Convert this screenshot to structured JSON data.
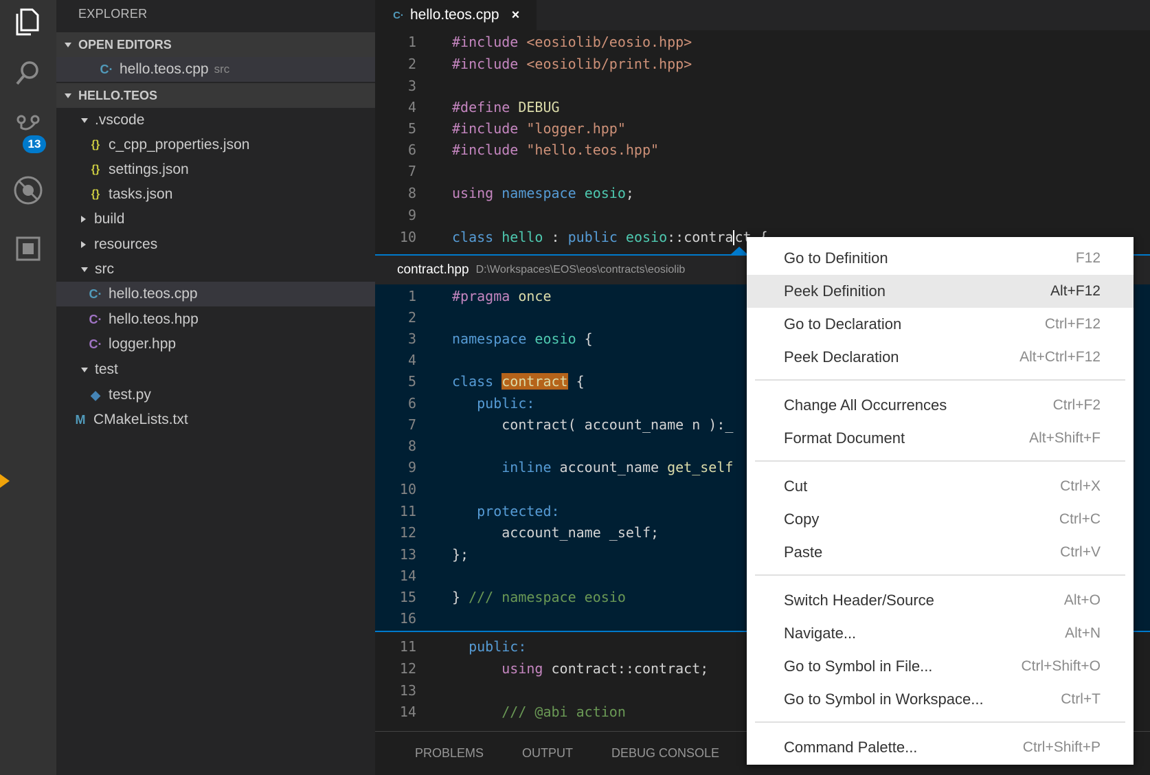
{
  "activity": {
    "scm_badge": "13"
  },
  "sidebar": {
    "title": "EXPLORER",
    "open_editors_label": "OPEN EDITORS",
    "open_editor": {
      "name": "hello.teos.cpp",
      "hint": "src"
    },
    "project_label": "HELLO.TEOS",
    "tree": [
      {
        "label": ".vscode",
        "type": "folder-open"
      },
      {
        "label": "c_cpp_properties.json",
        "type": "json"
      },
      {
        "label": "settings.json",
        "type": "json"
      },
      {
        "label": "tasks.json",
        "type": "json"
      },
      {
        "label": "build",
        "type": "folder-closed"
      },
      {
        "label": "resources",
        "type": "folder-closed"
      },
      {
        "label": "src",
        "type": "folder-open"
      },
      {
        "label": "hello.teos.cpp",
        "type": "cpp"
      },
      {
        "label": "hello.teos.hpp",
        "type": "hpp"
      },
      {
        "label": "logger.hpp",
        "type": "hpp"
      },
      {
        "label": "test",
        "type": "folder-open"
      },
      {
        "label": "test.py",
        "type": "py"
      },
      {
        "label": "CMakeLists.txt",
        "type": "cmake"
      }
    ],
    "icons": {
      "json": "{}",
      "cpp": "C·",
      "hpp": "C·",
      "py": "◆",
      "cmake": "M"
    }
  },
  "editor": {
    "tab_label": "hello.teos.cpp",
    "close_glyph": "×",
    "top_lines": [
      "1",
      "2",
      "3",
      "4",
      "5",
      "6",
      "7",
      "8",
      "9",
      "10"
    ],
    "peek": {
      "file": "contract.hpp",
      "path": "D:\\Workspaces\\EOS\\eos\\contracts\\eosiolib",
      "lines": [
        "1",
        "2",
        "3",
        "4",
        "5",
        "6",
        "7",
        "8",
        "9",
        "10",
        "11",
        "12",
        "13",
        "14",
        "15",
        "16"
      ]
    },
    "bottom_lines": [
      "11",
      "12",
      "13",
      "14"
    ]
  },
  "panel": {
    "tabs": [
      "PROBLEMS",
      "OUTPUT",
      "DEBUG CONSOLE"
    ]
  },
  "context_menu": {
    "items": [
      {
        "label": "Go to Definition",
        "key": "F12"
      },
      {
        "label": "Peek Definition",
        "key": "Alt+F12"
      },
      {
        "label": "Go to Declaration",
        "key": "Ctrl+F12"
      },
      {
        "label": "Peek Declaration",
        "key": "Alt+Ctrl+F12"
      },
      {
        "label": "Change All Occurrences",
        "key": "Ctrl+F2"
      },
      {
        "label": "Format Document",
        "key": "Alt+Shift+F"
      },
      {
        "label": "Cut",
        "key": "Ctrl+X"
      },
      {
        "label": "Copy",
        "key": "Ctrl+C"
      },
      {
        "label": "Paste",
        "key": "Ctrl+V"
      },
      {
        "label": "Switch Header/Source",
        "key": "Alt+O"
      },
      {
        "label": "Navigate...",
        "key": "Alt+N"
      },
      {
        "label": "Go to Symbol in File...",
        "key": "Ctrl+Shift+O"
      },
      {
        "label": "Go to Symbol in Workspace...",
        "key": "Ctrl+T"
      },
      {
        "label": "Command Palette...",
        "key": "Ctrl+Shift+P"
      }
    ]
  },
  "colors": {
    "accent": "#007acc",
    "highlight": "#b5631a"
  }
}
